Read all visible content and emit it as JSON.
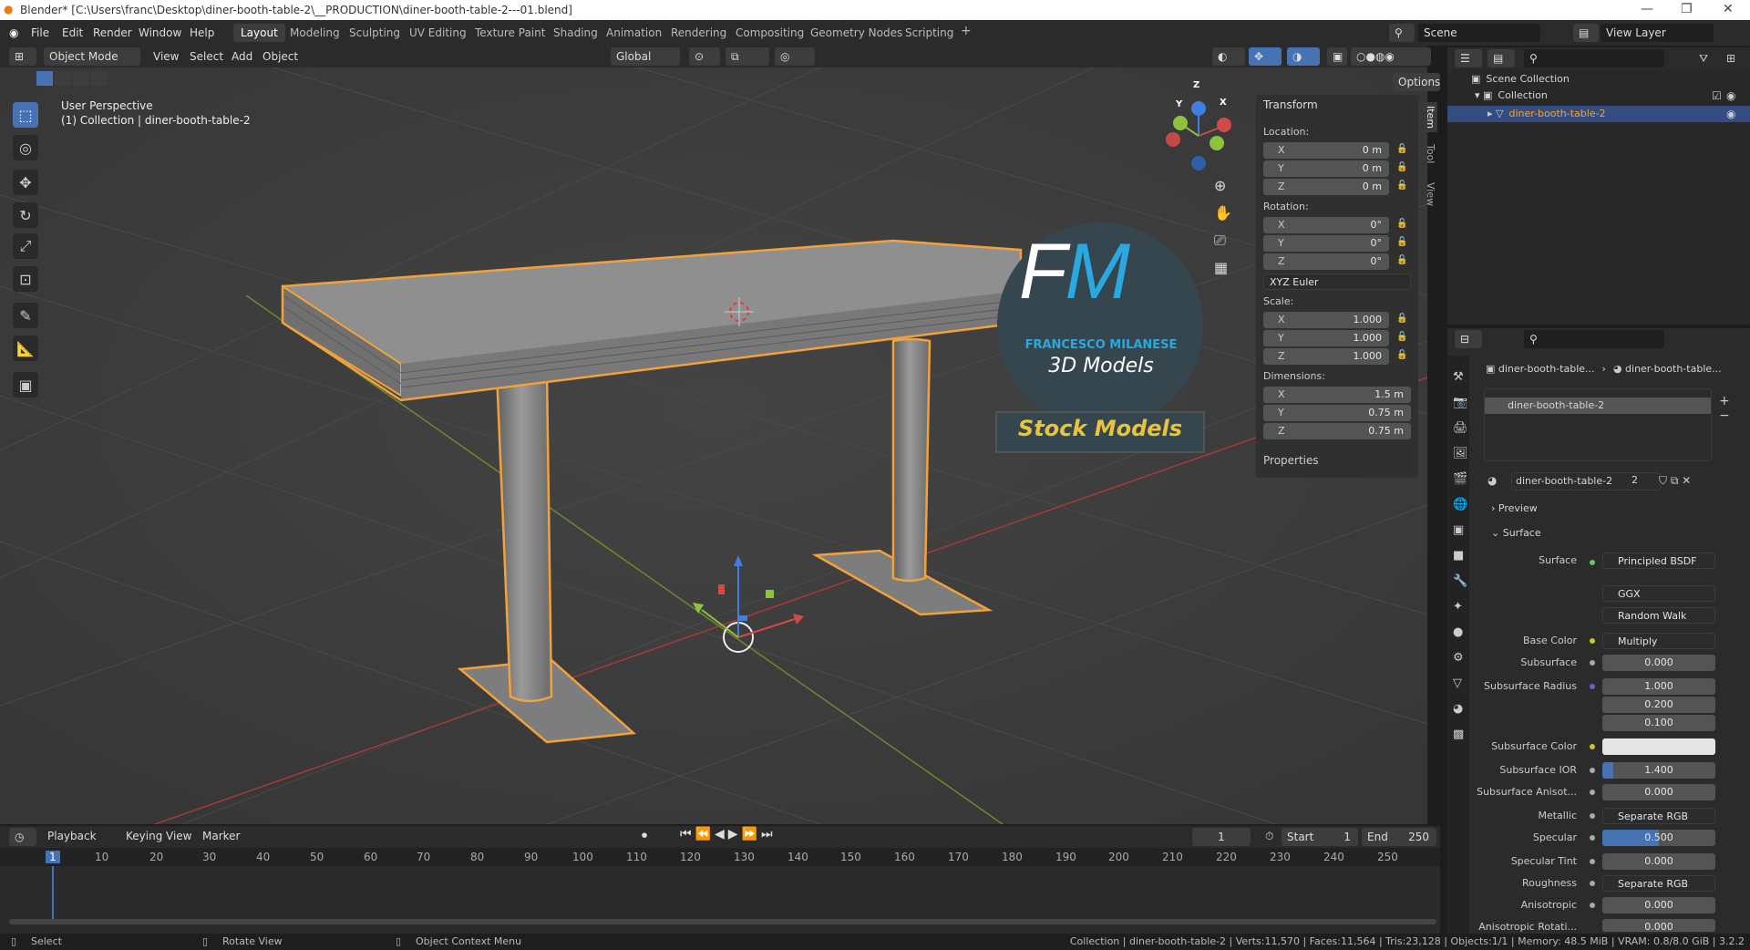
{
  "titlebar": {
    "title": "Blender* [C:\\Users\\franc\\Desktop\\diner-booth-table-2\\__PRODUCTION\\diner-booth-table-2---01.blend]"
  },
  "menu": {
    "file": "File",
    "edit": "Edit",
    "render": "Render",
    "window": "Window",
    "help": "Help"
  },
  "workspaces": [
    "Layout",
    "Modeling",
    "Sculpting",
    "UV Editing",
    "Texture Paint",
    "Shading",
    "Animation",
    "Rendering",
    "Compositing",
    "Geometry Nodes",
    "Scripting"
  ],
  "topright": {
    "scene": "Scene",
    "view_layer": "View Layer"
  },
  "viewport_header": {
    "mode": "Object Mode",
    "view": "View",
    "select": "Select",
    "add": "Add",
    "object": "Object",
    "orientation": "Global",
    "options": "Options"
  },
  "viewport": {
    "perspective": "User Perspective",
    "collection": "(1) Collection | diner-booth-table-2"
  },
  "gizmo": {
    "x": "X",
    "y": "Y",
    "z": "Z"
  },
  "watermark": {
    "initials": "FM",
    "name": "FRANCESCO MILANESE",
    "subtitle": "3D Models",
    "banner": "Stock Models"
  },
  "npanel": {
    "header": "Transform",
    "location_label": "Location:",
    "location": {
      "x": "0 m",
      "y": "0 m",
      "z": "0 m"
    },
    "rotation_label": "Rotation:",
    "rotation": {
      "x": "0°",
      "y": "0°",
      "z": "0°"
    },
    "rotation_mode": "XYZ Euler",
    "scale_label": "Scale:",
    "scale": {
      "x": "1.000",
      "y": "1.000",
      "z": "1.000"
    },
    "dimensions_label": "Dimensions:",
    "dimensions": {
      "x": "1.5 m",
      "y": "0.75 m",
      "z": "0.75 m"
    },
    "properties": "Properties",
    "axis": {
      "x": "X",
      "y": "Y",
      "z": "Z"
    },
    "tabs": {
      "item": "Item",
      "tool": "Tool",
      "view": "View"
    }
  },
  "outliner": {
    "scene_collection": "Scene Collection",
    "collection": "Collection",
    "object": "diner-booth-table-2"
  },
  "properties": {
    "breadcrumb": {
      "object": "diner-booth-table...",
      "material": "diner-booth-table..."
    },
    "slot": "diner-booth-table-2",
    "material_name": "diner-booth-table-2",
    "users": "2",
    "preview": "Preview",
    "surface_panel": "Surface",
    "surface_label": "Surface",
    "surface_value": "Principled BSDF",
    "distribution": "GGX",
    "subsurface_method": "Random Walk",
    "rows": [
      {
        "label": "Base Color",
        "value": "Multiply"
      },
      {
        "label": "Subsurface",
        "value": "0.000"
      },
      {
        "label": "Subsurface Radius",
        "value": "1.000"
      },
      {
        "label": "",
        "value": "0.200"
      },
      {
        "label": "",
        "value": "0.100"
      },
      {
        "label": "Subsurface Color",
        "value": ""
      },
      {
        "label": "Subsurface IOR",
        "value": "1.400"
      },
      {
        "label": "Subsurface Anisot...",
        "value": "0.000"
      },
      {
        "label": "Metallic",
        "value": "Separate RGB"
      },
      {
        "label": "Specular",
        "value": "0.500"
      },
      {
        "label": "Specular Tint",
        "value": "0.000"
      },
      {
        "label": "Roughness",
        "value": "Separate RGB"
      },
      {
        "label": "Anisotropic",
        "value": "0.000"
      },
      {
        "label": "Anisotropic Rotati...",
        "value": "0.000"
      }
    ]
  },
  "timeline": {
    "playback": "Playback",
    "keying": "Keying",
    "view": "View",
    "marker": "Marker",
    "current_frame": "1",
    "start_label": "Start",
    "start": "1",
    "end_label": "End",
    "end": "250",
    "ticks": [
      "1",
      "10",
      "20",
      "30",
      "40",
      "50",
      "60",
      "70",
      "80",
      "90",
      "100",
      "110",
      "120",
      "130",
      "140",
      "150",
      "160",
      "170",
      "180",
      "190",
      "200",
      "210",
      "220",
      "230",
      "240",
      "250"
    ]
  },
  "statusbar": {
    "select": "Select",
    "rotate": "Rotate View",
    "context": "Object Context Menu",
    "stats": "Collection | diner-booth-table-2 | Verts:11,570 | Faces:11,564 | Tris:23,128 | Objects:1/1 | Memory: 48.5 MiB | VRAM: 0.8/8.0 GiB | 3.2.2"
  },
  "colors": {
    "accent": "#4772b3",
    "selection": "#f2a23a",
    "x_axis": "#d04a4a",
    "y_axis": "#8dc33a",
    "z_axis": "#3f7fe0"
  }
}
